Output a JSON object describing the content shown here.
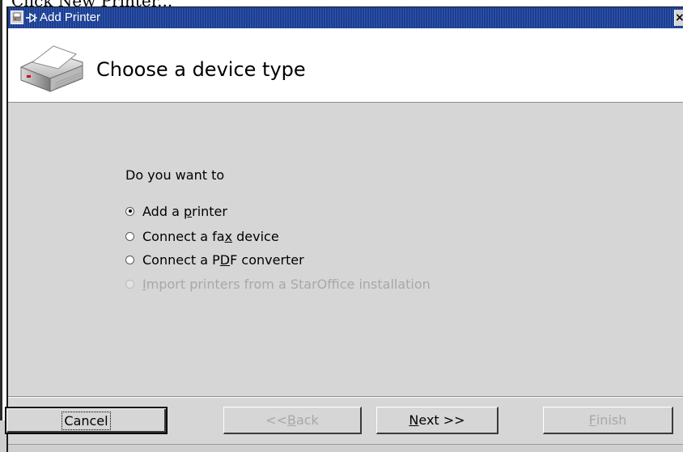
{
  "background": {
    "caption": "Click New Printer..."
  },
  "window": {
    "title": "Add Printer",
    "close_glyph": "×"
  },
  "header": {
    "title": "Choose a device type",
    "icon": "printer-icon"
  },
  "content": {
    "prompt": "Do you want to",
    "options": [
      {
        "pre": "Add a ",
        "ul": "p",
        "post": "rinter",
        "selected": true,
        "enabled": true
      },
      {
        "pre": "Connect a fa",
        "ul": "x",
        "post": " device",
        "selected": false,
        "enabled": true
      },
      {
        "pre": "Connect a P",
        "ul": "D",
        "post": "F converter",
        "selected": false,
        "enabled": true
      },
      {
        "pre": "",
        "ul": "I",
        "post": "mport printers from a StarOffice installation",
        "selected": false,
        "enabled": false
      }
    ]
  },
  "buttons": {
    "cancel": {
      "pre": "",
      "ul": "",
      "post": "Cancel",
      "enabled": true
    },
    "back": {
      "pre": "<< ",
      "ul": "B",
      "post": "ack",
      "enabled": false
    },
    "next": {
      "pre": "",
      "ul": "N",
      "post": "ext >>",
      "enabled": true
    },
    "finish": {
      "pre": "",
      "ul": "F",
      "post": "inish",
      "enabled": false
    }
  },
  "colors": {
    "titlebar": "#1e3e8c",
    "dialog_bg": "#d6d6d6",
    "disabled_text": "#a8a8a8"
  }
}
